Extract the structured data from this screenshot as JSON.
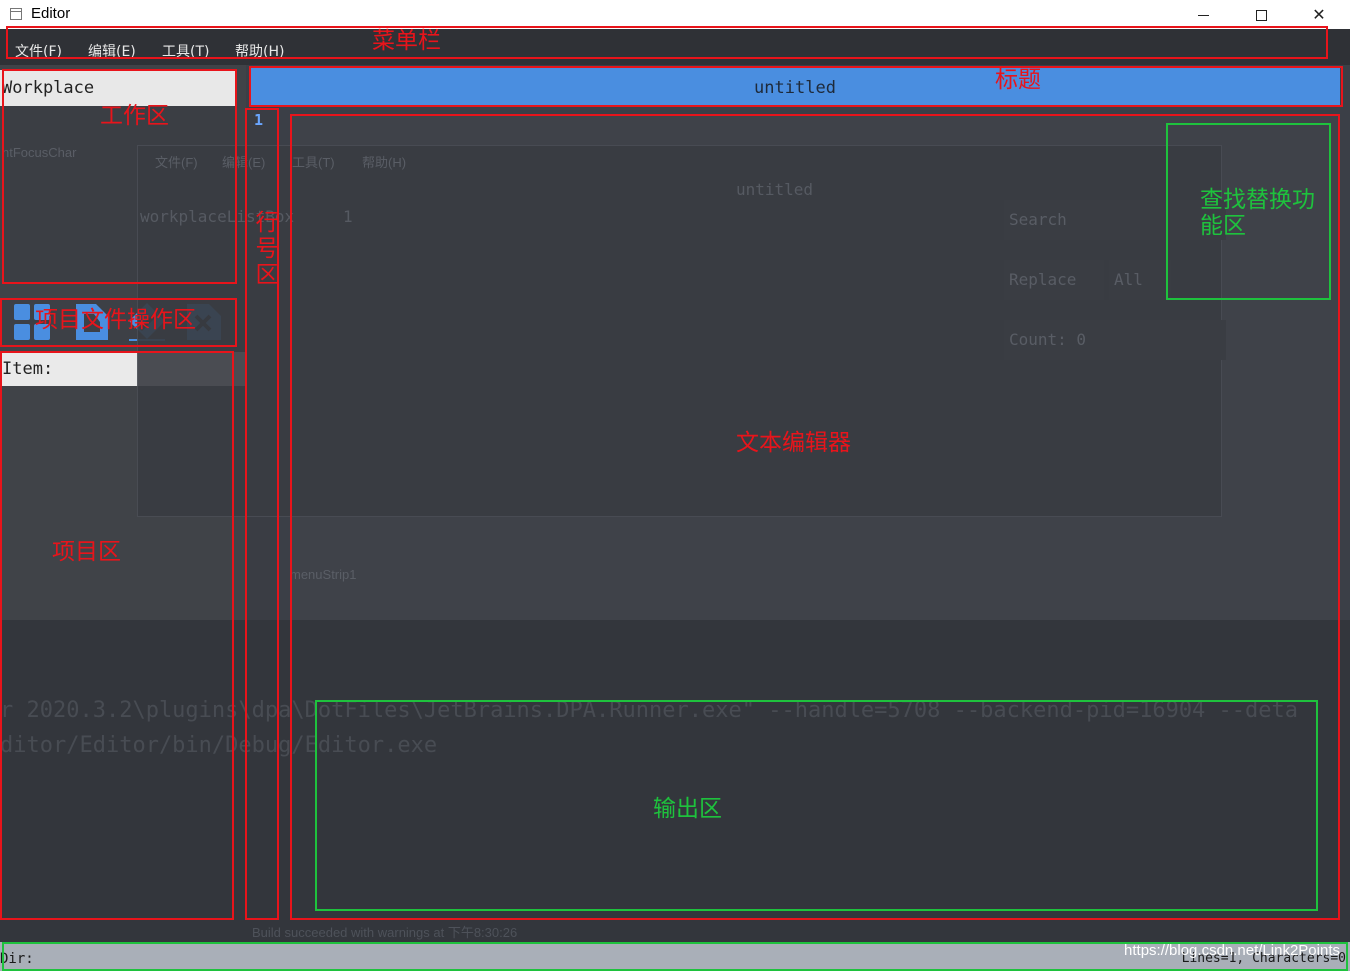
{
  "window": {
    "title": "Editor",
    "controls": {
      "minimize": "",
      "maximize": "",
      "close": "✕"
    }
  },
  "menubar": {
    "items": [
      {
        "label": "文件(F)"
      },
      {
        "label": "编辑(E)"
      },
      {
        "label": "工具(T)"
      },
      {
        "label": "帮助(H)"
      }
    ]
  },
  "workplace": {
    "header": "Workplace"
  },
  "project_toolbar": {
    "icons": [
      "new-project-icon",
      "new-file-icon",
      "rename-icon",
      "delete-icon"
    ]
  },
  "items": {
    "header": "Item:"
  },
  "gutter": {
    "line_numbers": [
      "1"
    ]
  },
  "document": {
    "title": "untitled"
  },
  "background_ghost": {
    "focus_label": "ntFocusChar",
    "menu": [
      "文件(F)",
      "编辑(E)",
      "工具(T)",
      "帮助(H)"
    ],
    "doc_title": "untitled",
    "workplace": "workplaceListBox",
    "line": "1",
    "menu_strip": "menuStrip1"
  },
  "find_replace": {
    "search_placeholder": "Search",
    "replace_placeholder": "Replace",
    "all_label": "All",
    "count_label": "Count: 0"
  },
  "output": {
    "lines": [
      "r 2020.3.2\\plugins\\dpa\\DotFiles\\JetBrains.DPA.Runner.exe\" --handle=5708 --backend-pid=16904 --deta",
      "ditor/Editor/bin/Debug/Editor.exe"
    ],
    "build_message": "Build succeeded with warnings at 下午8:30:26"
  },
  "statusbar": {
    "dir_label": "Dir:",
    "stats": "Lines=1, Characters=0"
  },
  "watermark": "https://blog.csdn.net/Link2Points",
  "annotations": {
    "menubar": "菜单栏",
    "title": "标题",
    "workplace": "工作区",
    "line_number": "行号区",
    "project_file_ops": "项目文件操作区",
    "project": "项目区",
    "text_editor": "文本编辑器",
    "find_replace": "查找替换功能区",
    "output": "输出区"
  },
  "colors": {
    "accent": "#4a8ee0",
    "annotation_red": "#e8141b",
    "annotation_green": "#1ec23d",
    "editor_bg": "#3f4249",
    "statusbar_bg": "#a9afb8"
  }
}
